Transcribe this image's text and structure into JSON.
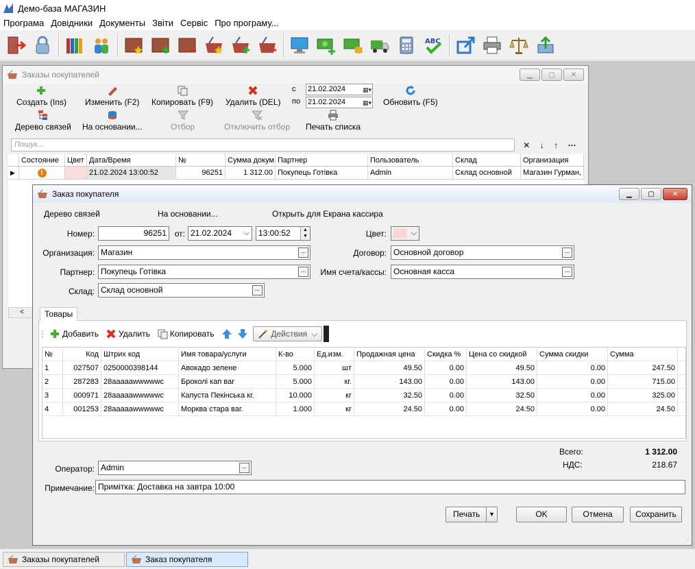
{
  "app": {
    "title": "Демо-база МАГАЗИН"
  },
  "menu": [
    "Програма",
    "Довідники",
    "Документы",
    "Звіти",
    "Сервіс",
    "Про програму..."
  ],
  "toolbar_icons": [
    "exit-icon",
    "lock-icon",
    "books-icon",
    "users-icon",
    "folder-star-icon",
    "folder-plus-icon",
    "folder-minus-icon",
    "basket-star-icon",
    "basket-plus-icon",
    "basket-minus-icon",
    "monitor-icon",
    "money-plus-icon",
    "money-coins-icon",
    "truck-icon",
    "calculator-icon",
    "spellcheck-icon",
    "export-icon",
    "printer-icon",
    "scales-icon",
    "upload-icon"
  ],
  "list_window": {
    "title": "Заказы покупателей",
    "buttons": {
      "create": "Создать (Ins)",
      "edit": "Изменить (F2)",
      "copy": "Копировать (F9)",
      "delete": "Удалить (DEL)",
      "refresh": "Обновить (F5)",
      "tree": "Дерево связей",
      "based_on": "На основании...",
      "filter": "Отбор",
      "filter_off": "Отключить отбор",
      "print_list": "Печать списка"
    },
    "date_from_label": "с",
    "date_to_label": "по",
    "date_from": "21.02.2024",
    "date_to": "21.02.2024",
    "search_placeholder": "Пошук...",
    "search_tools": [
      "✕",
      "↓",
      "↑",
      "···"
    ],
    "columns": [
      "Состояние",
      "Цвет",
      "Дата/Время",
      "№",
      "Сумма докум",
      "Партнер",
      "Пользователь",
      "Склад",
      "Организация"
    ],
    "row": {
      "state": "!",
      "color": "",
      "datetime": "21.02.2024 13:00:52",
      "number": "96251",
      "sum": "1 312.00",
      "partner": "Покупець Готівка",
      "user": "Admin",
      "warehouse": "Склад основной",
      "organization": "Магазин Гурман,"
    }
  },
  "order_window": {
    "title": "Заказ покупателя",
    "links": {
      "tree": "Дерево связей",
      "based_on": "На основании...",
      "open_cashier": "Открыть для Екрана кассира"
    },
    "labels": {
      "number": "Номер:",
      "from": "от:",
      "organization": "Организация:",
      "partner": "Партнер:",
      "warehouse": "Склад:",
      "color": "Цвет:",
      "contract": "Договор:",
      "account": "Имя счета/кассы:",
      "operator": "Оператор:",
      "note": "Примечание:"
    },
    "values": {
      "number": "96251",
      "date": "21.02.2024",
      "time": "13:00:52",
      "organization": "Магазин",
      "partner": "Покупець Готівка",
      "warehouse": "Склад основной",
      "contract": "Основной договор",
      "account": "Основная касса",
      "operator": "Admin",
      "note": "Примітка: Доставка на завтра 10:00",
      "color_hex": "#f8d6d6"
    },
    "tab": "Товары",
    "item_toolbar": {
      "add": "Добавить",
      "delete": "Удалить",
      "copy": "Копировать",
      "actions": "Действия"
    },
    "item_columns": [
      "№",
      "Код",
      "Штрих код",
      "Имя товара/услуги",
      "К-во",
      "Ед.изм.",
      "Продажная цена",
      "Скидка %",
      "Цена со скидкой",
      "Сумма скидки",
      "Сумма"
    ],
    "items": [
      {
        "n": "1",
        "code": "027507",
        "barcode": "0250000398144",
        "name": "Авокадо зелене",
        "qty": "5.000",
        "unit": "шт",
        "price": "49.50",
        "discount": "0.00",
        "disc_price": "49.50",
        "disc_sum": "0.00",
        "sum": "247.50"
      },
      {
        "n": "2",
        "code": "287283",
        "barcode": "28aaaaawwwwwc",
        "name": "Броколі кап ваг",
        "qty": "5.000",
        "unit": "кг.",
        "price": "143.00",
        "discount": "0.00",
        "disc_price": "143.00",
        "disc_sum": "0.00",
        "sum": "715.00"
      },
      {
        "n": "3",
        "code": "000971",
        "barcode": "28aaaaawwwwwc",
        "name": "Капуста Пекінська кг.",
        "qty": "10.000",
        "unit": "кг",
        "price": "32.50",
        "discount": "0.00",
        "disc_price": "32.50",
        "disc_sum": "0.00",
        "sum": "325.00"
      },
      {
        "n": "4",
        "code": "001253",
        "barcode": "28aaaaawwwwwc",
        "name": "Морква стара  ваг.",
        "qty": "1.000",
        "unit": "кг",
        "price": "24.50",
        "discount": "0.00",
        "disc_price": "24.50",
        "disc_sum": "0.00",
        "sum": "24.50"
      }
    ],
    "totals": {
      "total_label": "Всего:",
      "total": "1 312.00",
      "vat_label": "НДС:",
      "vat": "218.67"
    },
    "buttons": {
      "print": "Печать",
      "ok": "OK",
      "cancel": "Отмена",
      "save": "Сохранить"
    }
  },
  "taskbar": [
    "Заказы покупателей",
    "Заказ покупателя"
  ]
}
